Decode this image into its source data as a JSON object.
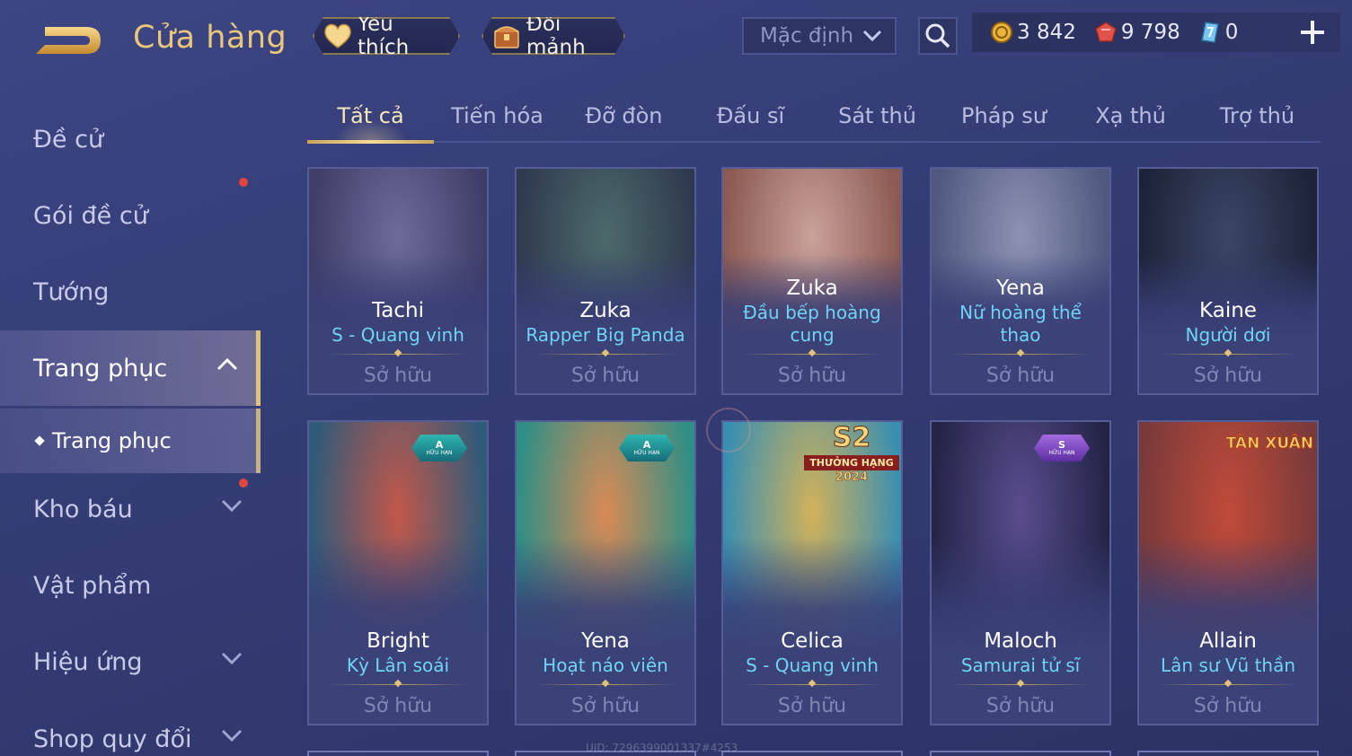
{
  "header": {
    "title": "Cửa hàng",
    "favorites_label": "Yêu thích",
    "exchange_label": "Đổi mảnh",
    "sort_value": "Mặc định"
  },
  "currencies": [
    {
      "name": "gold-coin",
      "value": "3 842",
      "color": "#e8b43a"
    },
    {
      "name": "red-voucher",
      "value": "9 798",
      "color": "#e0524a"
    },
    {
      "name": "blue-quantum",
      "value": "0",
      "color": "#79c6f2"
    }
  ],
  "sidebar": {
    "items": [
      {
        "label": "Đề cử"
      },
      {
        "label": "Gói đề cử"
      },
      {
        "label": "Tướng"
      },
      {
        "label": "Trang phục"
      },
      {
        "label": "Kho báu"
      },
      {
        "label": "Vật phẩm"
      },
      {
        "label": "Hiệu ứng"
      },
      {
        "label": "Shop quy đổi"
      }
    ],
    "sub_item": "Trang phục"
  },
  "tabs": [
    "Tất cả",
    "Tiến hóa",
    "Đỡ đòn",
    "Đấu sĩ",
    "Sát thủ",
    "Pháp sư",
    "Xạ thủ",
    "Trợ thủ"
  ],
  "cards": [
    {
      "hero": "Tachi",
      "skin": "S - Quang vinh",
      "status": "Sở hữu",
      "palette": [
        "#6d6c99",
        "#3f3e68"
      ]
    },
    {
      "hero": "Zuka",
      "skin": "Rapper Big Panda",
      "status": "Sở hữu",
      "palette": [
        "#4c6a6a",
        "#2f3a4f"
      ]
    },
    {
      "hero": "Zuka",
      "skin": "Đầu bếp hoàng cung",
      "status": "Sở hữu",
      "palette": [
        "#c9a29a",
        "#8c5a53"
      ]
    },
    {
      "hero": "Yena",
      "skin": "Nữ hoàng thể thao",
      "status": "Sở hữu",
      "palette": [
        "#8d93b4",
        "#50587f"
      ]
    },
    {
      "hero": "Kaine",
      "skin": "Người dơi",
      "status": "Sở hữu",
      "palette": [
        "#3b4566",
        "#1d2338"
      ]
    },
    {
      "hero": "Bright",
      "skin": "Kỳ Lân soái",
      "status": "Sở hữu",
      "palette": [
        "#c2584a",
        "#2f5a7a"
      ],
      "badge": "A",
      "badge_sub": "HỮU HẠN"
    },
    {
      "hero": "Yena",
      "skin": "Hoạt náo viên",
      "status": "Sở hữu",
      "palette": [
        "#d98a55",
        "#2f8f86"
      ],
      "badge": "A",
      "badge_sub": "HỮU HẠN"
    },
    {
      "hero": "Celica",
      "skin": "S - Quang vinh",
      "status": "Sở hữu",
      "palette": [
        "#d1b25a",
        "#3a8fb0"
      ],
      "rank": "S2",
      "rank_text": "THƯỞNG HẠNG",
      "rank_year": "2024"
    },
    {
      "hero": "Maloch",
      "skin": "Samurai tử sĩ",
      "status": "Sở hữu",
      "palette": [
        "#5a4d8f",
        "#242447"
      ],
      "badge": "S",
      "badge_sub": "HỮU HẠN"
    },
    {
      "hero": "Allain",
      "skin": "Lân sư Vũ thần",
      "status": "Sở hữu",
      "palette": [
        "#c04a3a",
        "#7a3a3a"
      ],
      "event": "TÂN XUÂN"
    }
  ],
  "watermark": "UID: 7296399001337#4253"
}
